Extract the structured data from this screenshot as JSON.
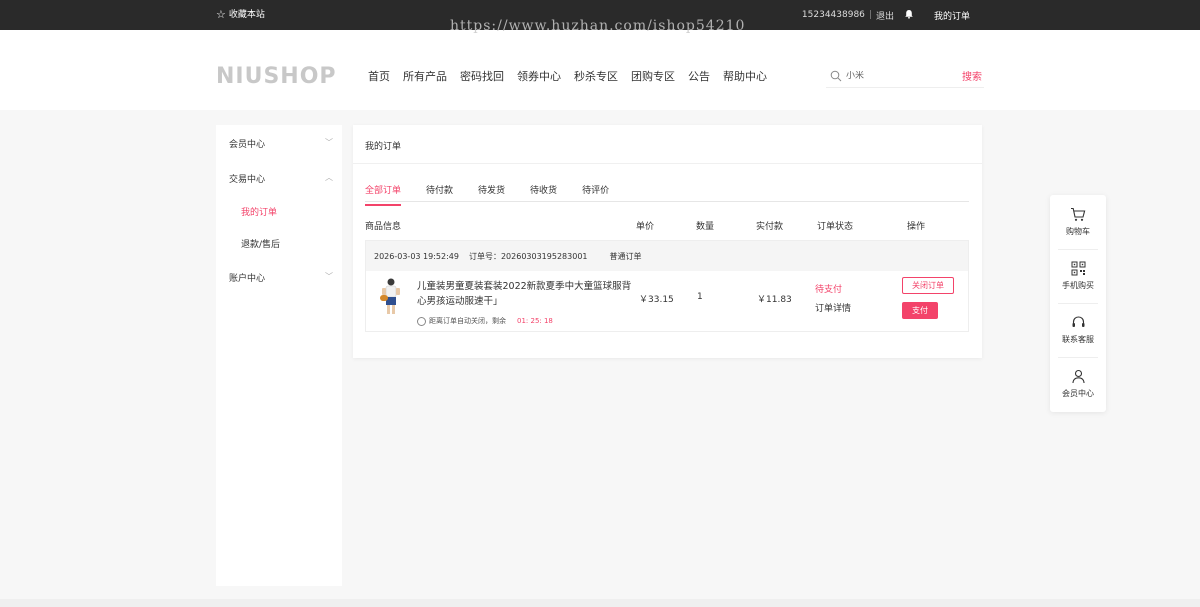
{
  "topbar": {
    "favorite": "收藏本站",
    "phone": "15234438986",
    "separator": "|",
    "logout": "退出",
    "my_orders": "我的订单"
  },
  "watermark": "https://www.huzhan.com/ishop54210",
  "header": {
    "logo": "NIUSHOP",
    "nav": [
      "首页",
      "所有产品",
      "密码找回",
      "领券中心",
      "秒杀专区",
      "团购专区",
      "公告",
      "帮助中心"
    ],
    "search_placeholder": "小米",
    "search_button": "搜索"
  },
  "sidebar": {
    "member_center": "会员中心",
    "trade_center": "交易中心",
    "my_orders": "我的订单",
    "refund": "退款/售后",
    "account_center": "账户中心"
  },
  "panel": {
    "title": "我的订单",
    "tabs": [
      "全部订单",
      "待付款",
      "待发货",
      "待收货",
      "待评价"
    ],
    "columns": {
      "goods": "商品信息",
      "price": "单价",
      "qty": "数量",
      "paid": "实付款",
      "status": "订单状态",
      "action": "操作"
    },
    "order": {
      "time": "2026-03-03 19:52:49",
      "order_no": "订单号：20260303195283001",
      "type": "普通订单",
      "goods_name": "儿童装男童夏装套装2022新款夏季中大童篮球服背心男孩运动服速干」",
      "countdown_label": "距离订单自动关闭，剩余",
      "countdown": "01: 25: 18",
      "price": "￥33.15",
      "qty": "1",
      "paid": "￥11.83",
      "status": "待支付",
      "detail": "订单详情",
      "close_button": "关闭订单",
      "pay_button": "支付"
    }
  },
  "floatbar": {
    "cart": "购物车",
    "mobile": "手机购买",
    "service": "联系客服",
    "member": "会员中心"
  },
  "colors": {
    "accent": "#f3436a",
    "topbar": "#2a2a2a"
  }
}
